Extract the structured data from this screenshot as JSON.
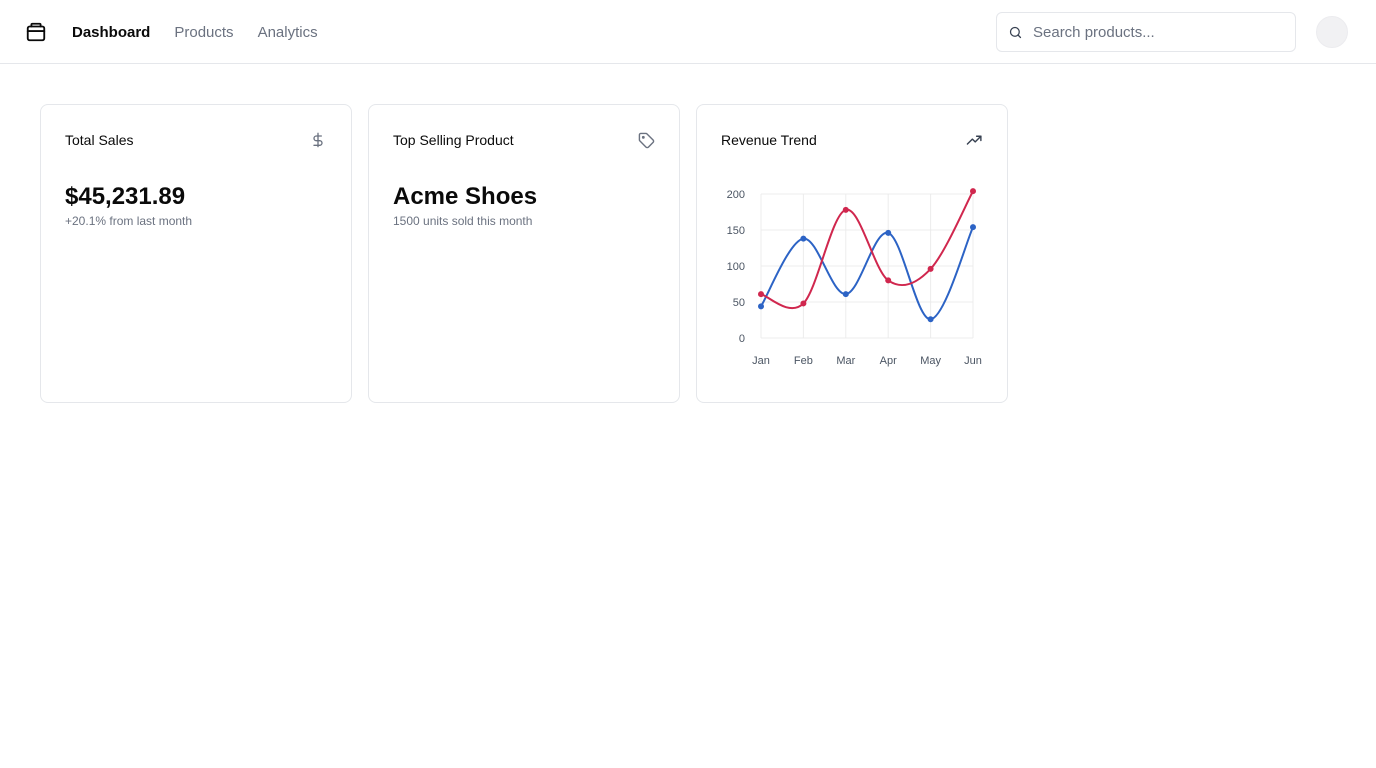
{
  "header": {
    "nav": [
      {
        "label": "Dashboard",
        "active": true
      },
      {
        "label": "Products",
        "active": false
      },
      {
        "label": "Analytics",
        "active": false
      }
    ],
    "search": {
      "placeholder": "Search products...",
      "value": "",
      "icon": "search-icon"
    },
    "logo_icon": "package-icon"
  },
  "cards": [
    {
      "title": "Total Sales",
      "icon": "dollar-icon",
      "value": "$45,231.89",
      "sub": "+20.1% from last month"
    },
    {
      "title": "Top Selling Product",
      "icon": "tag-icon",
      "value": "Acme Shoes",
      "sub": "1500 units sold this month"
    },
    {
      "title": "Revenue Trend",
      "icon": "trending-up-icon"
    }
  ],
  "colors": {
    "series_blue": "#2c63c5",
    "series_red": "#d0274e",
    "grid": "#ececec",
    "border": "#e5e7eb",
    "muted": "#6b7280"
  },
  "chart_data": {
    "type": "line",
    "categories": [
      "Jan",
      "Feb",
      "Mar",
      "Apr",
      "May",
      "Jun"
    ],
    "ylim": [
      0,
      200
    ],
    "yticks": [
      0,
      50,
      100,
      150,
      200
    ],
    "grid": true,
    "legend": "none",
    "series": [
      {
        "color": "#2c63c5",
        "values": [
          44,
          138,
          61,
          146,
          26,
          154
        ]
      },
      {
        "color": "#d0274e",
        "values": [
          61,
          48,
          178,
          80,
          96,
          204
        ]
      }
    ]
  }
}
